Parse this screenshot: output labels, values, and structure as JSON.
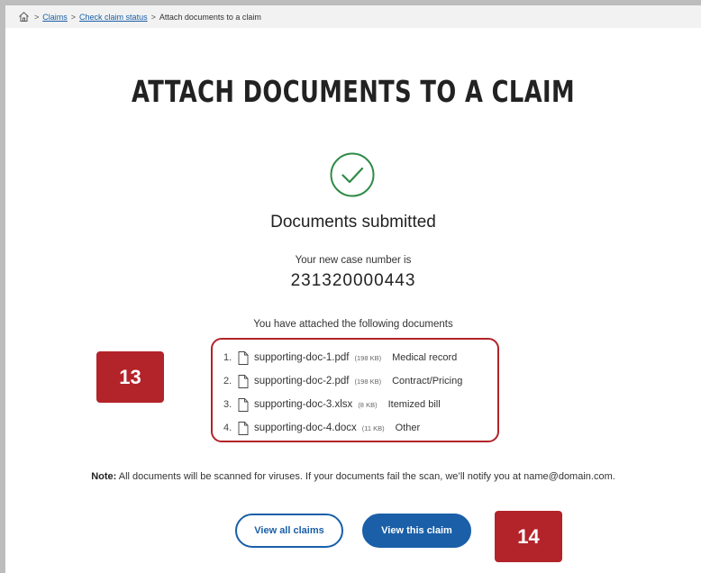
{
  "breadcrumb": {
    "home_icon": "home-icon",
    "separator": ">",
    "items": [
      {
        "label": "Claims"
      },
      {
        "label": "Check claim status"
      },
      {
        "label": "Attach documents to a claim"
      }
    ]
  },
  "page": {
    "title": "ATTACH DOCUMENTS TO A CLAIM",
    "status_icon": "check-circle-icon",
    "status_heading": "Documents submitted",
    "case_label": "Your new case number is",
    "case_number": "231320000443",
    "attached_intro": "You have attached the following documents"
  },
  "documents": [
    {
      "num": "1.",
      "name": "supporting-doc-1.pdf",
      "size": "(198 KB)",
      "type": "Medical record"
    },
    {
      "num": "2.",
      "name": "supporting-doc-2.pdf",
      "size": "(198 KB)",
      "type": "Contract/Pricing"
    },
    {
      "num": "3.",
      "name": "supporting-doc-3.xlsx",
      "size": "(8 KB)",
      "type": "Itemized bill"
    },
    {
      "num": "4.",
      "name": "supporting-doc-4.docx",
      "size": "(11 KB)",
      "type": "Other"
    }
  ],
  "note": {
    "label": "Note:",
    "text": " All documents will be scanned for viruses. If your documents fail the scan, we’ll notify you at name@domain.com."
  },
  "actions": {
    "view_all": "View all claims",
    "view_this": "View this claim"
  },
  "annotations": {
    "badge_a": "13",
    "badge_b": "14"
  },
  "colors": {
    "accent_blue": "#1a5fa8",
    "success_green": "#2e8b46",
    "annotation_red": "#b3232a"
  }
}
